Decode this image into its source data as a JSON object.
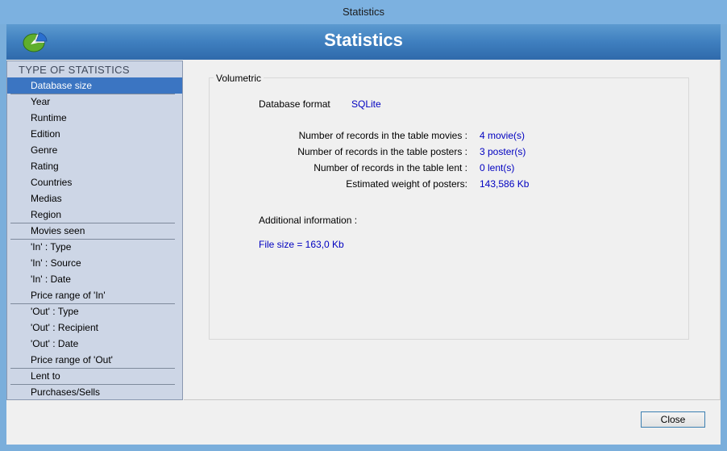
{
  "window": {
    "title": "Statistics"
  },
  "banner": {
    "title": "Statistics"
  },
  "sidebar": {
    "header": "TYPE OF STATISTICS",
    "items": [
      {
        "label": "Database size",
        "selected": true
      },
      {
        "label": "Year"
      },
      {
        "label": "Runtime"
      },
      {
        "label": "Edition"
      },
      {
        "label": "Genre"
      },
      {
        "label": "Rating"
      },
      {
        "label": "Countries"
      },
      {
        "label": "Medias"
      },
      {
        "label": "Region"
      },
      {
        "label": "Movies seen"
      },
      {
        "label": "'In' : Type"
      },
      {
        "label": "'In' : Source"
      },
      {
        "label": "'In' : Date"
      },
      {
        "label": "Price range of 'In'"
      },
      {
        "label": "'Out' : Type"
      },
      {
        "label": "'Out' : Recipient"
      },
      {
        "label": "'Out' : Date"
      },
      {
        "label": "Price range of 'Out'"
      },
      {
        "label": "Lent to"
      },
      {
        "label": "Purchases/Sells"
      }
    ]
  },
  "volumetric": {
    "group_label": "Volumetric",
    "db_format_label": "Database format",
    "db_format_value": "SQLite",
    "rows": [
      {
        "label": "Number of records in the table movies :",
        "value": "4 movie(s)"
      },
      {
        "label": "Number of records in the table posters :",
        "value": "3 poster(s)"
      },
      {
        "label": "Number of records in the table lent :",
        "value": "0 lent(s)"
      },
      {
        "label": "Estimated weight of posters:",
        "value": "143,586 Kb"
      }
    ],
    "additional_label": "Additional information :",
    "file_size": "File size = 163,0 Kb"
  },
  "buttons": {
    "close": "Close"
  },
  "colors": {
    "selection": "#3b75c2",
    "value_text": "#0000c0",
    "banner": "#3f7fbf"
  },
  "icons": {
    "app_logo": "pie-chart-icon"
  }
}
